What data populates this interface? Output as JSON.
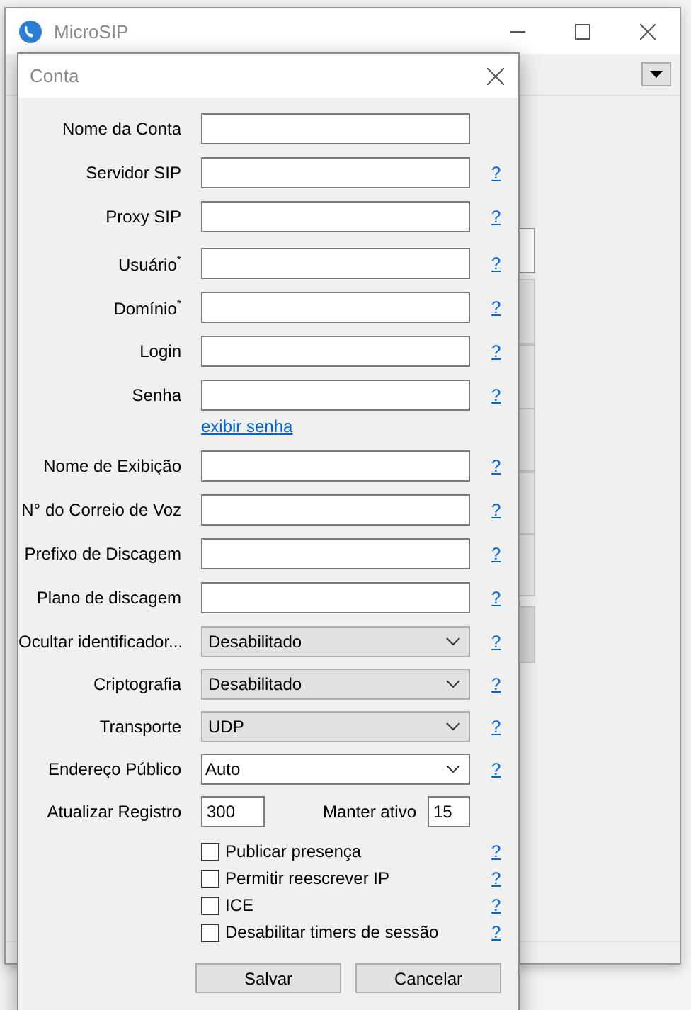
{
  "main_window": {
    "title": "MicroSIP"
  },
  "dialog": {
    "title": "Conta",
    "fields": [
      {
        "kind": "text",
        "label": "Nome da Conta"
      },
      {
        "kind": "text",
        "label": "Servidor SIP",
        "help": "?"
      },
      {
        "kind": "text",
        "label": "Proxy SIP",
        "help": "?"
      },
      {
        "kind": "text",
        "label": "Usuário$^{*}$",
        "help": "?",
        "gap_before": true
      },
      {
        "kind": "text",
        "label": "Domínio$^{*}$",
        "help": "?"
      },
      {
        "kind": "text",
        "label": "Login",
        "help": "?"
      },
      {
        "kind": "text",
        "label": "Senha",
        "help": "?"
      },
      {
        "kind": "link",
        "text": "exibir senha"
      },
      {
        "kind": "text",
        "label": "Nome de Exibição",
        "help": "?"
      },
      {
        "kind": "text",
        "label": "N° do Correio de Voz",
        "help": "?"
      },
      {
        "kind": "text",
        "label": "Prefixo de Discagem",
        "help": "?"
      },
      {
        "kind": "text",
        "label": "Plano de discagem",
        "help": "?"
      },
      {
        "kind": "select",
        "label": "Ocultar identificador...",
        "value": "Desabilitado",
        "help": "?"
      },
      {
        "kind": "select",
        "label": "Criptografia",
        "value": "Desabilitado",
        "help": "?"
      },
      {
        "kind": "select",
        "label": "Transporte",
        "value": "UDP",
        "help": "?"
      },
      {
        "kind": "combo",
        "label": "Endereço Público",
        "value": "Auto",
        "help": "?"
      },
      {
        "kind": "pair",
        "label": "Atualizar Registro",
        "value": "300",
        "label_2": "Manter ativo",
        "value_2": "15"
      },
      {
        "kind": "checkbox",
        "label": "Publicar presença",
        "checked": false,
        "help": "?"
      },
      {
        "kind": "checkbox",
        "label": "Permitir reescrever IP",
        "checked": false,
        "help": "?"
      },
      {
        "kind": "checkbox",
        "label": "ICE",
        "checked": false,
        "help": "?"
      },
      {
        "kind": "checkbox",
        "label": "Desabilitar timers de sessão",
        "checked": false,
        "help": "?"
      }
    ],
    "buttons": [
      "Salvar",
      "Cancelar"
    ]
  }
}
